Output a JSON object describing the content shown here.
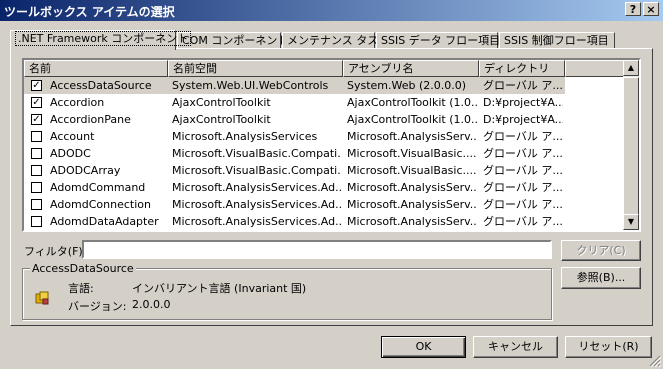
{
  "window": {
    "title": "ツールボックス アイテムの選択",
    "help_button": "?",
    "close_button": "×"
  },
  "tabs": [
    {
      "label": ".NET Framework コンポーネント",
      "active": true
    },
    {
      "label": "COM コンポーネント",
      "active": false
    },
    {
      "label": "メンテナンス タスク",
      "active": false
    },
    {
      "label": "SSIS データ フロー項目",
      "active": false
    },
    {
      "label": "SSIS 制御フロー項目",
      "active": false
    }
  ],
  "list": {
    "columns": [
      "名前",
      "名前空間",
      "アセンブリ名",
      "ディレクトリ"
    ],
    "rows": [
      {
        "checked": true,
        "name": "AccessDataSource",
        "namespace": "System.Web.UI.WebControls",
        "assembly": "System.Web (2.0.0.0)",
        "directory": "グローバル ア..."
      },
      {
        "checked": true,
        "name": "Accordion",
        "namespace": "AjaxControlToolkit",
        "assembly": "AjaxControlToolkit (1.0....",
        "directory": "D:¥project¥A..."
      },
      {
        "checked": true,
        "name": "AccordionPane",
        "namespace": "AjaxControlToolkit",
        "assembly": "AjaxControlToolkit (1.0....",
        "directory": "D:¥project¥A..."
      },
      {
        "checked": false,
        "name": "Account",
        "namespace": "Microsoft.AnalysisServices",
        "assembly": "Microsoft.AnalysisServ...",
        "directory": "グローバル ア..."
      },
      {
        "checked": false,
        "name": "ADODC",
        "namespace": "Microsoft.VisualBasic.Compati...",
        "assembly": "Microsoft.VisualBasic....",
        "directory": "グローバル ア..."
      },
      {
        "checked": false,
        "name": "ADODCArray",
        "namespace": "Microsoft.VisualBasic.Compati...",
        "assembly": "Microsoft.VisualBasic....",
        "directory": "グローバル ア..."
      },
      {
        "checked": false,
        "name": "AdomdCommand",
        "namespace": "Microsoft.AnalysisServices.Ad...",
        "assembly": "Microsoft.AnalysisServ...",
        "directory": "グローバル ア..."
      },
      {
        "checked": false,
        "name": "AdomdConnection",
        "namespace": "Microsoft.AnalysisServices.Ad...",
        "assembly": "Microsoft.AnalysisServ...",
        "directory": "グローバル ア..."
      },
      {
        "checked": false,
        "name": "AdomdDataAdapter",
        "namespace": "Microsoft.AnalysisServices.Ad...",
        "assembly": "Microsoft.AnalysisServ...",
        "directory": "グローバル ア..."
      }
    ]
  },
  "filter": {
    "label": "フィルタ(F):",
    "value": "",
    "clear_button": "クリア(C)"
  },
  "details": {
    "group_title": "AccessDataSource",
    "language_label": "言語:",
    "language_value": "インバリアント言語 (Invariant 国)",
    "version_label": "バージョン:",
    "version_value": "2.0.0.0"
  },
  "browse_button": "参照(B)...",
  "footer": {
    "ok": "OK",
    "cancel": "キャンセル",
    "reset": "リセット(R)"
  },
  "colors": {
    "face": "#d4d0c8",
    "title_start": "#0a246a",
    "title_end": "#a6caf0"
  }
}
